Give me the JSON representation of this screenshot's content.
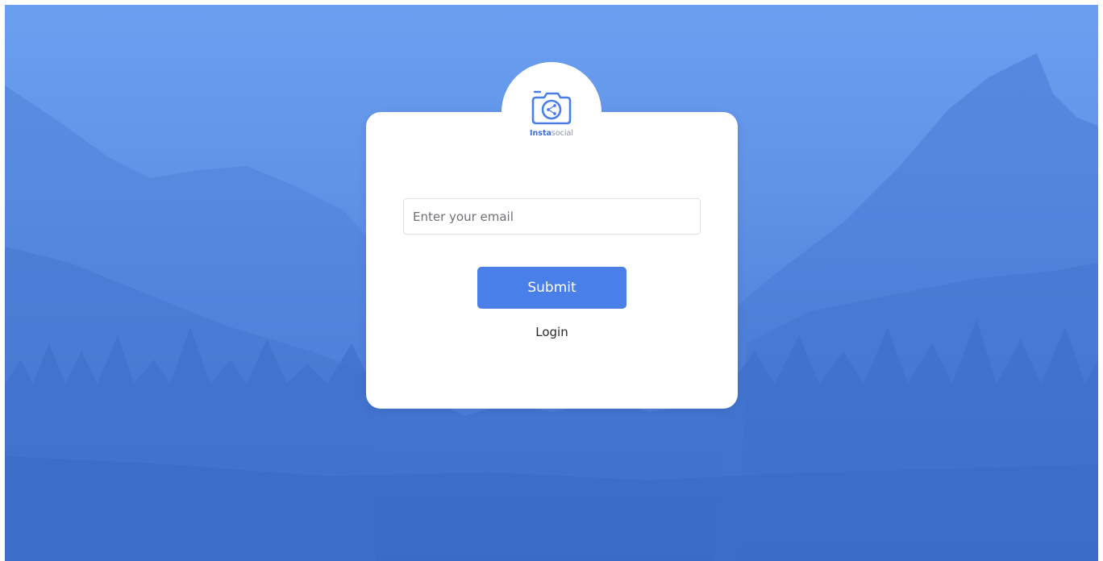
{
  "brand": {
    "name_part1": "Insta",
    "name_part2": "social",
    "icon": "camera-share-icon",
    "color": "#3f6fd6"
  },
  "form": {
    "email_placeholder": "Enter your email",
    "email_value": "",
    "submit_label": "Submit",
    "login_label": "Login"
  },
  "colors": {
    "accent": "#4a7fe8",
    "background_top": "#6b9ff0",
    "background_bottom": "#3f73cf"
  }
}
